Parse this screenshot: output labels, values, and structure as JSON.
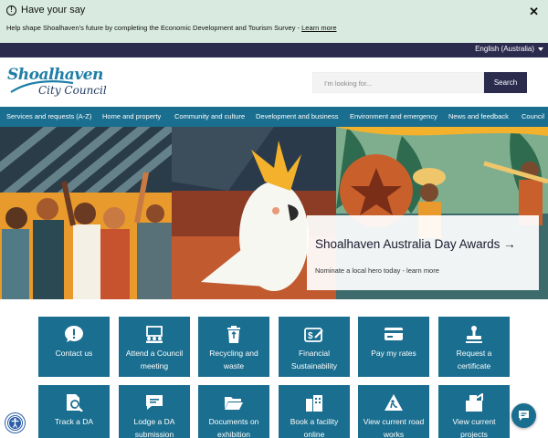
{
  "alert": {
    "title": "Have your say",
    "text": "Help shape Shoalhaven's future by completing the Economic Development and Tourism Survey - ",
    "link": "Learn more",
    "close": "✕"
  },
  "language": {
    "selected": "English (Australia)"
  },
  "logo": {
    "line1": "Shoalhaven",
    "line2": "City Council"
  },
  "search": {
    "placeholder": "I'm looking for...",
    "button": "Search"
  },
  "nav": {
    "items": [
      "Services and requests (A-Z)",
      "Home and property",
      "Community and culture",
      "Development and business",
      "Environment and emergency",
      "News and feedback",
      "Council"
    ]
  },
  "hero": {
    "title": "Shoalhaven Australia Day Awards →",
    "subtitle": "Nominate a local hero today - learn more"
  },
  "tiles": [
    {
      "label": "Contact us",
      "icon": "comment-alert-icon"
    },
    {
      "label": "Attend a Council meeting",
      "icon": "meeting-icon"
    },
    {
      "label": "Recycling and waste",
      "icon": "recycling-icon"
    },
    {
      "label": "Financial Sustainability",
      "icon": "finance-icon"
    },
    {
      "label": "Pay my rates",
      "icon": "credit-card-icon"
    },
    {
      "label": "Request a certificate",
      "icon": "stamp-icon"
    },
    {
      "label": "Track a DA",
      "icon": "document-search-icon"
    },
    {
      "label": "Lodge a DA submission",
      "icon": "message-icon"
    },
    {
      "label": "Documents on exhibition",
      "icon": "folder-open-icon"
    },
    {
      "label": "Book a facility online",
      "icon": "building-icon"
    },
    {
      "label": "View current road works",
      "icon": "road-works-icon"
    },
    {
      "label": "View current projects",
      "icon": "projects-icon"
    }
  ],
  "colors": {
    "alert_bg": "#d9ebe1",
    "topbar": "#2b2b4e",
    "brand_teal": "#1a6e8f",
    "hero_orange": "#e89a2c"
  }
}
